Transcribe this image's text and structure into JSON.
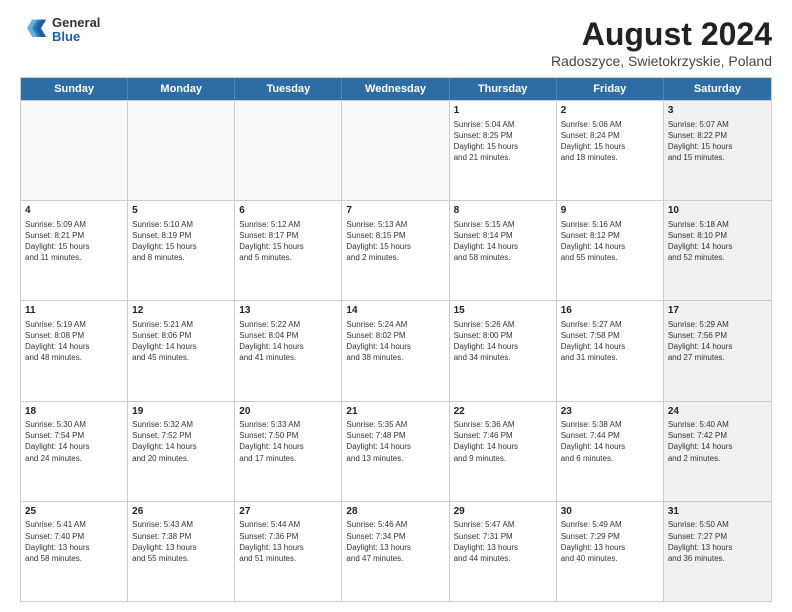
{
  "header": {
    "logo_line1": "General",
    "logo_line2": "Blue",
    "title": "August 2024",
    "subtitle": "Radoszyce, Swietokrzyskie, Poland"
  },
  "calendar": {
    "days_of_week": [
      "Sunday",
      "Monday",
      "Tuesday",
      "Wednesday",
      "Thursday",
      "Friday",
      "Saturday"
    ],
    "rows": [
      [
        {
          "day": "",
          "info": "",
          "empty": true
        },
        {
          "day": "",
          "info": "",
          "empty": true
        },
        {
          "day": "",
          "info": "",
          "empty": true
        },
        {
          "day": "",
          "info": "",
          "empty": true
        },
        {
          "day": "1",
          "info": "Sunrise: 5:04 AM\nSunset: 8:25 PM\nDaylight: 15 hours\nand 21 minutes."
        },
        {
          "day": "2",
          "info": "Sunrise: 5:06 AM\nSunset: 8:24 PM\nDaylight: 15 hours\nand 18 minutes."
        },
        {
          "day": "3",
          "info": "Sunrise: 5:07 AM\nSunset: 8:22 PM\nDaylight: 15 hours\nand 15 minutes.",
          "shaded": true
        }
      ],
      [
        {
          "day": "4",
          "info": "Sunrise: 5:09 AM\nSunset: 8:21 PM\nDaylight: 15 hours\nand 11 minutes."
        },
        {
          "day": "5",
          "info": "Sunrise: 5:10 AM\nSunset: 8:19 PM\nDaylight: 15 hours\nand 8 minutes."
        },
        {
          "day": "6",
          "info": "Sunrise: 5:12 AM\nSunset: 8:17 PM\nDaylight: 15 hours\nand 5 minutes."
        },
        {
          "day": "7",
          "info": "Sunrise: 5:13 AM\nSunset: 8:15 PM\nDaylight: 15 hours\nand 2 minutes."
        },
        {
          "day": "8",
          "info": "Sunrise: 5:15 AM\nSunset: 8:14 PM\nDaylight: 14 hours\nand 58 minutes."
        },
        {
          "day": "9",
          "info": "Sunrise: 5:16 AM\nSunset: 8:12 PM\nDaylight: 14 hours\nand 55 minutes."
        },
        {
          "day": "10",
          "info": "Sunrise: 5:18 AM\nSunset: 8:10 PM\nDaylight: 14 hours\nand 52 minutes.",
          "shaded": true
        }
      ],
      [
        {
          "day": "11",
          "info": "Sunrise: 5:19 AM\nSunset: 8:08 PM\nDaylight: 14 hours\nand 48 minutes."
        },
        {
          "day": "12",
          "info": "Sunrise: 5:21 AM\nSunset: 8:06 PM\nDaylight: 14 hours\nand 45 minutes."
        },
        {
          "day": "13",
          "info": "Sunrise: 5:22 AM\nSunset: 8:04 PM\nDaylight: 14 hours\nand 41 minutes."
        },
        {
          "day": "14",
          "info": "Sunrise: 5:24 AM\nSunset: 8:02 PM\nDaylight: 14 hours\nand 38 minutes."
        },
        {
          "day": "15",
          "info": "Sunrise: 5:26 AM\nSunset: 8:00 PM\nDaylight: 14 hours\nand 34 minutes."
        },
        {
          "day": "16",
          "info": "Sunrise: 5:27 AM\nSunset: 7:58 PM\nDaylight: 14 hours\nand 31 minutes."
        },
        {
          "day": "17",
          "info": "Sunrise: 5:29 AM\nSunset: 7:56 PM\nDaylight: 14 hours\nand 27 minutes.",
          "shaded": true
        }
      ],
      [
        {
          "day": "18",
          "info": "Sunrise: 5:30 AM\nSunset: 7:54 PM\nDaylight: 14 hours\nand 24 minutes."
        },
        {
          "day": "19",
          "info": "Sunrise: 5:32 AM\nSunset: 7:52 PM\nDaylight: 14 hours\nand 20 minutes."
        },
        {
          "day": "20",
          "info": "Sunrise: 5:33 AM\nSunset: 7:50 PM\nDaylight: 14 hours\nand 17 minutes."
        },
        {
          "day": "21",
          "info": "Sunrise: 5:35 AM\nSunset: 7:48 PM\nDaylight: 14 hours\nand 13 minutes."
        },
        {
          "day": "22",
          "info": "Sunrise: 5:36 AM\nSunset: 7:46 PM\nDaylight: 14 hours\nand 9 minutes."
        },
        {
          "day": "23",
          "info": "Sunrise: 5:38 AM\nSunset: 7:44 PM\nDaylight: 14 hours\nand 6 minutes."
        },
        {
          "day": "24",
          "info": "Sunrise: 5:40 AM\nSunset: 7:42 PM\nDaylight: 14 hours\nand 2 minutes.",
          "shaded": true
        }
      ],
      [
        {
          "day": "25",
          "info": "Sunrise: 5:41 AM\nSunset: 7:40 PM\nDaylight: 13 hours\nand 58 minutes."
        },
        {
          "day": "26",
          "info": "Sunrise: 5:43 AM\nSunset: 7:38 PM\nDaylight: 13 hours\nand 55 minutes."
        },
        {
          "day": "27",
          "info": "Sunrise: 5:44 AM\nSunset: 7:36 PM\nDaylight: 13 hours\nand 51 minutes."
        },
        {
          "day": "28",
          "info": "Sunrise: 5:46 AM\nSunset: 7:34 PM\nDaylight: 13 hours\nand 47 minutes."
        },
        {
          "day": "29",
          "info": "Sunrise: 5:47 AM\nSunset: 7:31 PM\nDaylight: 13 hours\nand 44 minutes."
        },
        {
          "day": "30",
          "info": "Sunrise: 5:49 AM\nSunset: 7:29 PM\nDaylight: 13 hours\nand 40 minutes."
        },
        {
          "day": "31",
          "info": "Sunrise: 5:50 AM\nSunset: 7:27 PM\nDaylight: 13 hours\nand 36 minutes.",
          "shaded": true
        }
      ]
    ]
  }
}
